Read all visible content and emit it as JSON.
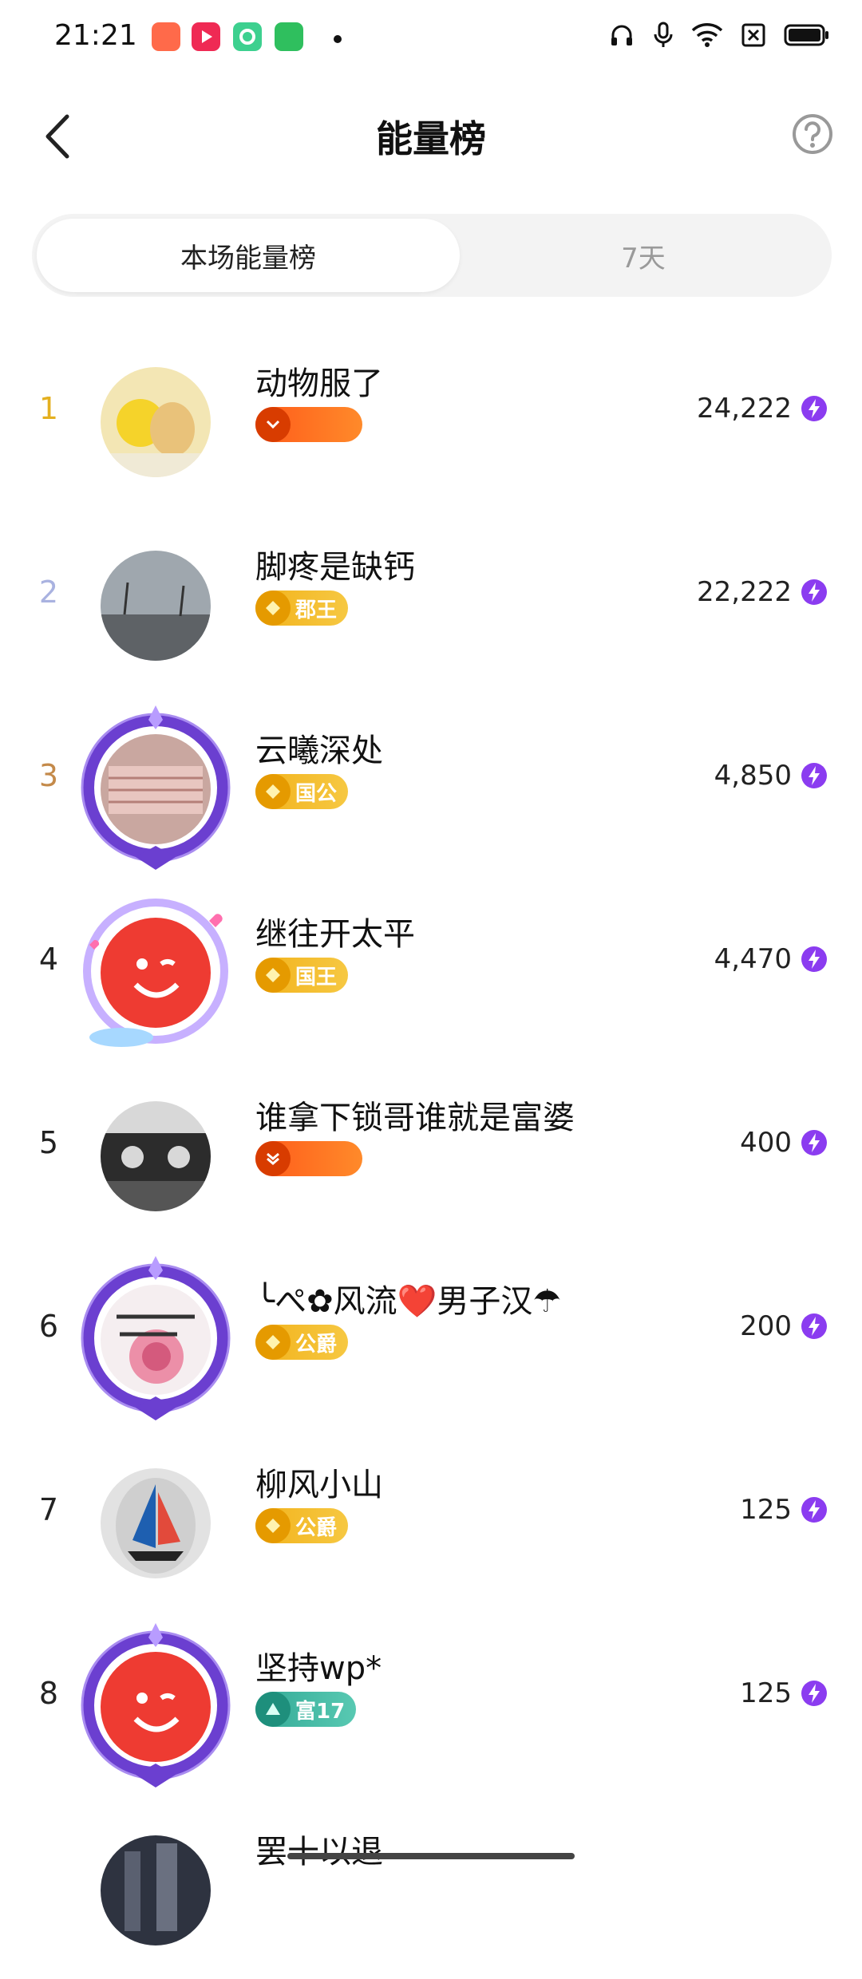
{
  "status_bar": {
    "time": "21:21"
  },
  "header": {
    "title": "能量榜"
  },
  "tabs": {
    "active_label": "本场能量榜",
    "inactive_label": "7天"
  },
  "colors": {
    "rank1": "#e4b020",
    "rank2": "#a9b2e0",
    "rank3": "#c48a4a",
    "badge_orange": "#ff6a1a",
    "badge_gold": "#f2b21b",
    "badge_teal": "#3cb6a3",
    "energy_purple": "#8b3cf0"
  },
  "rows": [
    {
      "rank": "1",
      "name": "动物服了",
      "badge": "",
      "badge_type": "orange",
      "score": "24,222"
    },
    {
      "rank": "2",
      "name": "脚疼是缺钙",
      "badge": "郡王",
      "badge_type": "gold",
      "score": "22,222"
    },
    {
      "rank": "3",
      "name": "云曦深处",
      "badge": "国公",
      "badge_type": "gold",
      "score": "4,850"
    },
    {
      "rank": "4",
      "name": "继往开太平",
      "badge": "国王",
      "badge_type": "gold",
      "score": "4,470"
    },
    {
      "rank": "5",
      "name": "谁拿下锁哥谁就是富婆",
      "badge": "",
      "badge_type": "orange",
      "score": "400"
    },
    {
      "rank": "6",
      "name": "╰ぺ✿风流❤️男子汉☂",
      "badge": "公爵",
      "badge_type": "gold",
      "score": "200"
    },
    {
      "rank": "7",
      "name": "柳风小山",
      "badge": "公爵",
      "badge_type": "gold",
      "score": "125"
    },
    {
      "rank": "8",
      "name": "坚持wp*",
      "badge": "富17",
      "badge_type": "teal",
      "score": "125"
    },
    {
      "rank": "",
      "name": "罢十以退",
      "badge": "",
      "badge_type": "none",
      "score": ""
    }
  ]
}
